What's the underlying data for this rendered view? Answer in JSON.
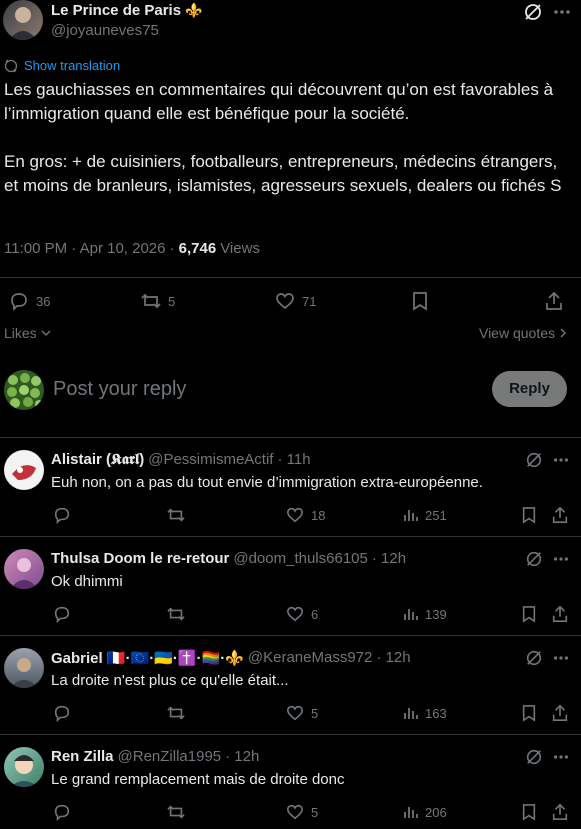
{
  "main_post": {
    "author_name": "Le Prince de Paris",
    "author_emoji": "⚜️",
    "handle": "@joyauneves75",
    "show_translation": "Show translation",
    "text_p1": "Les gauchiasses en commentaires qui découvrent qu’on est favorables à l’immigration quand elle est bénéfique pour la société.",
    "text_p2": "En gros: + de cuisiniers, footballeurs, entrepreneurs, médecins étrangers, et moins de branleurs, islamistes, agresseurs sexuels, dealers ou fichés S",
    "timestamp": "11:00 PM · Apr 10, 2026 ·",
    "views_count": "6,746",
    "views_label": "Views",
    "replies": "36",
    "reposts": "5",
    "likes": "71",
    "likes_link": "Likes",
    "view_quotes": "View quotes"
  },
  "composer": {
    "placeholder": "Post your reply",
    "reply_button": "Reply"
  },
  "replies": [
    {
      "name": "Alistair (𝕶𝖆𝖗𝖑)",
      "handle": "@PessimismeActif",
      "time": "· 11h",
      "text": "Euh non, on a pas du tout envie d’immigration extra-européenne.",
      "likes": "18",
      "views": "251"
    },
    {
      "name": "Thulsa Doom le re-retour",
      "handle": "@doom_thuls66105",
      "time": "· 12h",
      "text": "Ok dhimmi",
      "likes": "6",
      "views": "139"
    },
    {
      "name": "Gabriel 🇫🇷·🇪🇺·🇺🇦·✝️·🏳️‍🌈·⚜️",
      "handle": "@KeraneMass972",
      "time": "· 12h",
      "text": "La droite n'est plus ce qu'elle était...",
      "likes": "5",
      "views": "163"
    },
    {
      "name": "Ren Zilla",
      "handle": "@RenZilla1995",
      "time": "· 12h",
      "text": "Le grand remplacement mais de droite donc",
      "likes": "5",
      "views": "206"
    }
  ],
  "colors": {
    "background": "#000000",
    "link": "#1d9bf0",
    "muted": "#71767b",
    "separator": "#2f3336"
  }
}
